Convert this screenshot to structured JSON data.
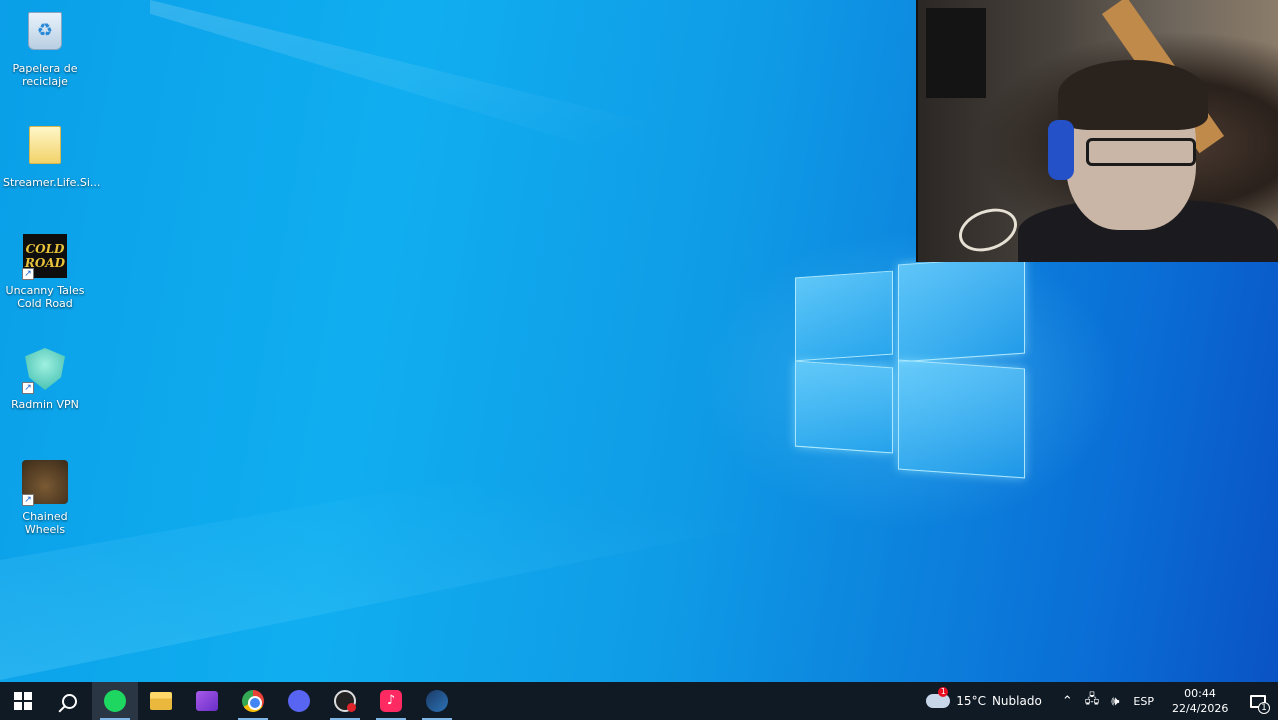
{
  "desktop": {
    "icons": [
      {
        "label": "Papelera de reciclaje",
        "icon": "recycle-bin-icon"
      },
      {
        "label": "Streamer.Life.Si...",
        "icon": "folder-icon"
      },
      {
        "label": "Uncanny Tales Cold Road",
        "icon": "cold-road-game-icon",
        "art_text": "COLD ROAD"
      },
      {
        "label": "Radmin VPN",
        "icon": "radmin-vpn-icon"
      },
      {
        "label": "Chained Wheels",
        "icon": "chained-wheels-game-icon"
      }
    ]
  },
  "taskbar": {
    "apps": [
      {
        "name": "spotify-icon",
        "running": true,
        "active": true
      },
      {
        "name": "file-explorer-icon",
        "running": false
      },
      {
        "name": "video-editor-icon",
        "running": false
      },
      {
        "name": "chrome-icon",
        "running": true
      },
      {
        "name": "discord-icon",
        "running": false
      },
      {
        "name": "obs-icon",
        "running": true
      },
      {
        "name": "tiktok-icon",
        "running": true
      },
      {
        "name": "steam-icon",
        "running": true
      }
    ],
    "weather": {
      "badge": "1",
      "temperature": "15°C",
      "condition": "Nublado"
    },
    "language": "ESP",
    "clock": {
      "time": "00:44",
      "date": "22/4/2026"
    },
    "notification_count": "1"
  },
  "colors": {
    "taskbar_bg": "#0f1a24",
    "desktop_blue": "#10aef0"
  }
}
